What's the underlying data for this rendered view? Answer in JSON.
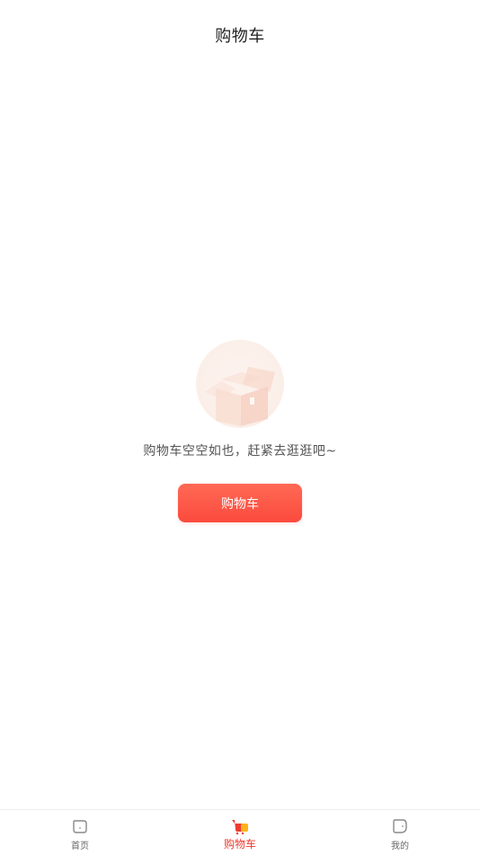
{
  "header": {
    "title": "购物车"
  },
  "empty_state": {
    "message": "购物车空空如也，赶紧去逛逛吧~",
    "button_label": "购物车",
    "illustration_icon": "empty-box-icon"
  },
  "tabbar": {
    "active_color": "#ee3b2f",
    "inactive_color": "#666666",
    "items": [
      {
        "label": "首页",
        "icon": "home-icon",
        "active": false
      },
      {
        "label": "购物车",
        "icon": "cart-icon",
        "active": true
      },
      {
        "label": "我的",
        "icon": "profile-icon",
        "active": false
      }
    ]
  },
  "colors": {
    "accent": "#fb4a3d",
    "text_primary": "#222222",
    "text_secondary": "#555555"
  }
}
